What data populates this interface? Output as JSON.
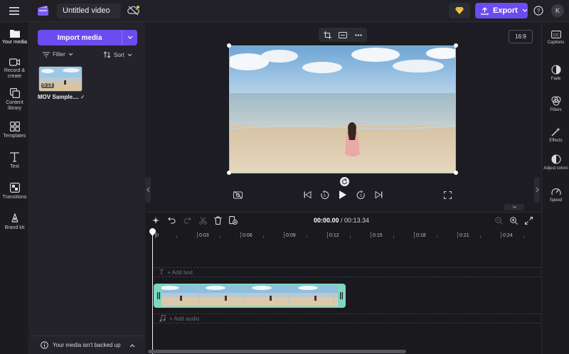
{
  "header": {
    "title": "Untitled video",
    "export_label": "Export",
    "avatar_initial": "K"
  },
  "leftnav": {
    "items": [
      {
        "label": "Your media",
        "icon": "folder-icon"
      },
      {
        "label": "Record & create",
        "icon": "camera-icon"
      },
      {
        "label": "Content library",
        "icon": "library-icon"
      },
      {
        "label": "Templates",
        "icon": "templates-icon"
      },
      {
        "label": "Text",
        "icon": "text-icon"
      },
      {
        "label": "Transitions",
        "icon": "transitions-icon"
      },
      {
        "label": "Brand kit",
        "icon": "brand-kit-icon"
      }
    ]
  },
  "media": {
    "import_label": "Import media",
    "filter_label": "Filter",
    "sort_label": "Sort",
    "asset": {
      "duration": "0:13",
      "name": "MOV Sample...."
    },
    "backup_text": "Your media isn't backed up"
  },
  "preview": {
    "aspect_ratio": "16:9"
  },
  "rightpanel": {
    "items": [
      {
        "label": "Captions",
        "icon": "captions-icon"
      },
      {
        "label": "Fade",
        "icon": "fade-icon"
      },
      {
        "label": "Filters",
        "icon": "filters-icon"
      },
      {
        "label": "Effects",
        "icon": "effects-icon"
      },
      {
        "label": "Adjust colors",
        "icon": "adjust-colors-icon"
      },
      {
        "label": "Speed",
        "icon": "speed-icon"
      }
    ]
  },
  "timeline": {
    "current_time": "00:00.00",
    "separator": " / ",
    "total_time": "00:13.34",
    "ticks": [
      "0",
      "0:03",
      "0:06",
      "0:09",
      "0:12",
      "0:15",
      "0:18",
      "0:21",
      "0:24"
    ],
    "add_text_label": "+ Add text",
    "add_audio_label": "+ Add audio"
  },
  "colors": {
    "accent": "#6a4cf0",
    "selection": "#7fd6c0",
    "background": "#1c1c22"
  }
}
